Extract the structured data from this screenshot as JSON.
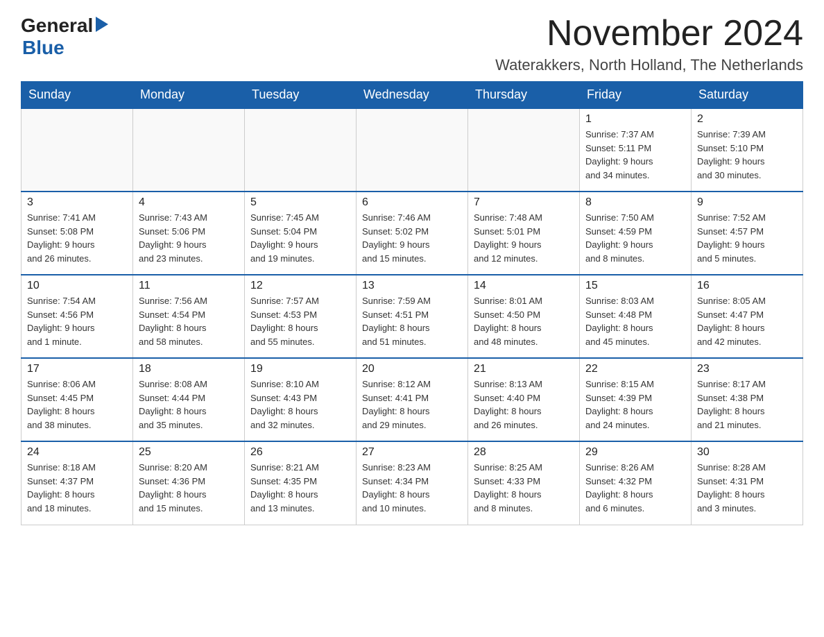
{
  "header": {
    "month_year": "November 2024",
    "location": "Waterakkers, North Holland, The Netherlands",
    "logo_general": "General",
    "logo_blue": "Blue"
  },
  "weekdays": [
    "Sunday",
    "Monday",
    "Tuesday",
    "Wednesday",
    "Thursday",
    "Friday",
    "Saturday"
  ],
  "weeks": [
    {
      "days": [
        {
          "number": "",
          "info": ""
        },
        {
          "number": "",
          "info": ""
        },
        {
          "number": "",
          "info": ""
        },
        {
          "number": "",
          "info": ""
        },
        {
          "number": "",
          "info": ""
        },
        {
          "number": "1",
          "info": "Sunrise: 7:37 AM\nSunset: 5:11 PM\nDaylight: 9 hours\nand 34 minutes."
        },
        {
          "number": "2",
          "info": "Sunrise: 7:39 AM\nSunset: 5:10 PM\nDaylight: 9 hours\nand 30 minutes."
        }
      ]
    },
    {
      "days": [
        {
          "number": "3",
          "info": "Sunrise: 7:41 AM\nSunset: 5:08 PM\nDaylight: 9 hours\nand 26 minutes."
        },
        {
          "number": "4",
          "info": "Sunrise: 7:43 AM\nSunset: 5:06 PM\nDaylight: 9 hours\nand 23 minutes."
        },
        {
          "number": "5",
          "info": "Sunrise: 7:45 AM\nSunset: 5:04 PM\nDaylight: 9 hours\nand 19 minutes."
        },
        {
          "number": "6",
          "info": "Sunrise: 7:46 AM\nSunset: 5:02 PM\nDaylight: 9 hours\nand 15 minutes."
        },
        {
          "number": "7",
          "info": "Sunrise: 7:48 AM\nSunset: 5:01 PM\nDaylight: 9 hours\nand 12 minutes."
        },
        {
          "number": "8",
          "info": "Sunrise: 7:50 AM\nSunset: 4:59 PM\nDaylight: 9 hours\nand 8 minutes."
        },
        {
          "number": "9",
          "info": "Sunrise: 7:52 AM\nSunset: 4:57 PM\nDaylight: 9 hours\nand 5 minutes."
        }
      ]
    },
    {
      "days": [
        {
          "number": "10",
          "info": "Sunrise: 7:54 AM\nSunset: 4:56 PM\nDaylight: 9 hours\nand 1 minute."
        },
        {
          "number": "11",
          "info": "Sunrise: 7:56 AM\nSunset: 4:54 PM\nDaylight: 8 hours\nand 58 minutes."
        },
        {
          "number": "12",
          "info": "Sunrise: 7:57 AM\nSunset: 4:53 PM\nDaylight: 8 hours\nand 55 minutes."
        },
        {
          "number": "13",
          "info": "Sunrise: 7:59 AM\nSunset: 4:51 PM\nDaylight: 8 hours\nand 51 minutes."
        },
        {
          "number": "14",
          "info": "Sunrise: 8:01 AM\nSunset: 4:50 PM\nDaylight: 8 hours\nand 48 minutes."
        },
        {
          "number": "15",
          "info": "Sunrise: 8:03 AM\nSunset: 4:48 PM\nDaylight: 8 hours\nand 45 minutes."
        },
        {
          "number": "16",
          "info": "Sunrise: 8:05 AM\nSunset: 4:47 PM\nDaylight: 8 hours\nand 42 minutes."
        }
      ]
    },
    {
      "days": [
        {
          "number": "17",
          "info": "Sunrise: 8:06 AM\nSunset: 4:45 PM\nDaylight: 8 hours\nand 38 minutes."
        },
        {
          "number": "18",
          "info": "Sunrise: 8:08 AM\nSunset: 4:44 PM\nDaylight: 8 hours\nand 35 minutes."
        },
        {
          "number": "19",
          "info": "Sunrise: 8:10 AM\nSunset: 4:43 PM\nDaylight: 8 hours\nand 32 minutes."
        },
        {
          "number": "20",
          "info": "Sunrise: 8:12 AM\nSunset: 4:41 PM\nDaylight: 8 hours\nand 29 minutes."
        },
        {
          "number": "21",
          "info": "Sunrise: 8:13 AM\nSunset: 4:40 PM\nDaylight: 8 hours\nand 26 minutes."
        },
        {
          "number": "22",
          "info": "Sunrise: 8:15 AM\nSunset: 4:39 PM\nDaylight: 8 hours\nand 24 minutes."
        },
        {
          "number": "23",
          "info": "Sunrise: 8:17 AM\nSunset: 4:38 PM\nDaylight: 8 hours\nand 21 minutes."
        }
      ]
    },
    {
      "days": [
        {
          "number": "24",
          "info": "Sunrise: 8:18 AM\nSunset: 4:37 PM\nDaylight: 8 hours\nand 18 minutes."
        },
        {
          "number": "25",
          "info": "Sunrise: 8:20 AM\nSunset: 4:36 PM\nDaylight: 8 hours\nand 15 minutes."
        },
        {
          "number": "26",
          "info": "Sunrise: 8:21 AM\nSunset: 4:35 PM\nDaylight: 8 hours\nand 13 minutes."
        },
        {
          "number": "27",
          "info": "Sunrise: 8:23 AM\nSunset: 4:34 PM\nDaylight: 8 hours\nand 10 minutes."
        },
        {
          "number": "28",
          "info": "Sunrise: 8:25 AM\nSunset: 4:33 PM\nDaylight: 8 hours\nand 8 minutes."
        },
        {
          "number": "29",
          "info": "Sunrise: 8:26 AM\nSunset: 4:32 PM\nDaylight: 8 hours\nand 6 minutes."
        },
        {
          "number": "30",
          "info": "Sunrise: 8:28 AM\nSunset: 4:31 PM\nDaylight: 8 hours\nand 3 minutes."
        }
      ]
    }
  ]
}
